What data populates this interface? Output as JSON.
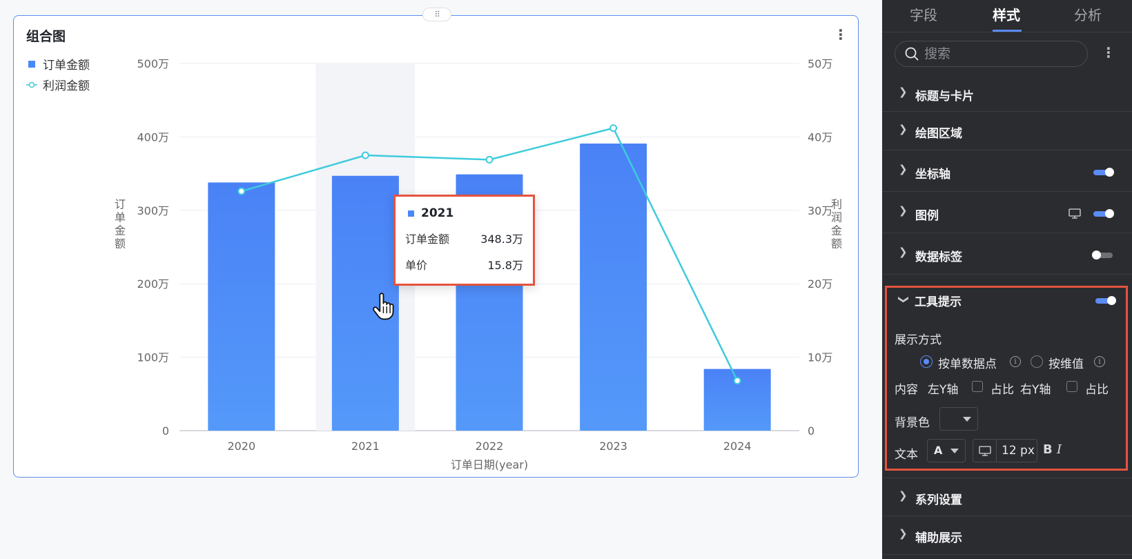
{
  "card": {
    "title": "组合图",
    "more_icon": "more-vertical-icon",
    "drag_icon": "drag-handle-icon",
    "drag_glyph": "⠿"
  },
  "legend": [
    {
      "label": "订单金额",
      "marker": "square",
      "color": "#4a88f7"
    },
    {
      "label": "利润金额",
      "marker": "line-circle",
      "color": "#3ecbdc"
    }
  ],
  "chart_data": {
    "type": "bar+line",
    "title": "组合图",
    "categories": [
      "2020",
      "2021",
      "2022",
      "2023",
      "2024"
    ],
    "series": [
      {
        "name": "订单金额",
        "type": "bar",
        "axis": "left",
        "color": "#4a88f7",
        "values": [
          338,
          347,
          349,
          391,
          84
        ]
      },
      {
        "name": "利润金额",
        "type": "line",
        "axis": "right",
        "color": "#3ecbdc",
        "values": [
          32.6,
          37.5,
          36.9,
          41.2,
          6.8
        ]
      }
    ],
    "xlabel": "订单日期(year)",
    "ylabel_left": "订单金额",
    "ylabel_right": "利润金额",
    "ylim_left": [
      0,
      500
    ],
    "ylim_right": [
      0,
      50
    ],
    "yticks_left": [
      "500万",
      "400万",
      "300万",
      "200万",
      "100万",
      "0"
    ],
    "yticks_right": [
      "50万",
      "40万",
      "30万",
      "20万",
      "10万",
      "0"
    ],
    "highlight_category": "2021",
    "grid": true,
    "legend_position": "top-left"
  },
  "tooltip": {
    "title": "2021",
    "rows": [
      {
        "label": "订单金额",
        "value": "348.3万"
      },
      {
        "label": "单价",
        "value": "15.8万"
      }
    ]
  },
  "cursor_icon": "hand-pointer-icon",
  "panel": {
    "tabs": [
      "字段",
      "样式",
      "分析"
    ],
    "active_tab": "样式",
    "search_placeholder": "搜索",
    "search_icon": "search-icon",
    "more_icon": "more-vertical-icon",
    "sections": [
      {
        "label": "标题与卡片",
        "toggle": null
      },
      {
        "label": "绘图区域",
        "toggle": null
      },
      {
        "label": "坐标轴",
        "toggle": "on"
      },
      {
        "label": "图例",
        "toggle": "on",
        "icon": "monitor-icon"
      },
      {
        "label": "数据标签",
        "toggle": "off"
      },
      {
        "label": "工具提示",
        "toggle": "on",
        "expanded": true
      },
      {
        "label": "系列设置",
        "toggle": null
      },
      {
        "label": "辅助展示",
        "toggle": null
      }
    ],
    "tooltip_settings": {
      "display_mode_label": "展示方式",
      "mode_options": [
        "按单数据点",
        "按维值"
      ],
      "mode_selected": "按单数据点",
      "content_label": "内容",
      "left_y_label": "左Y轴",
      "right_y_label": "右Y轴",
      "ratio_label": "占比",
      "left_ratio_checked": false,
      "right_ratio_checked": false,
      "bg_color_label": "背景色",
      "text_label": "文本",
      "text_color_glyph": "A",
      "font_size": "12 px",
      "bold_glyph": "B",
      "italic_glyph": "I"
    }
  }
}
